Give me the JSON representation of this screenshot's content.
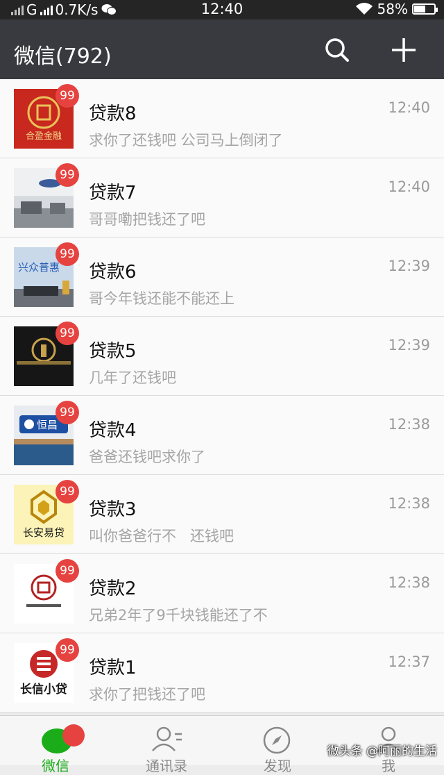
{
  "status_bar": {
    "carrier": "G",
    "speed": "0.7K/s",
    "time": "12:40",
    "battery": "58%",
    "battery_level": 0.58
  },
  "header": {
    "title": "微信(792)",
    "search_icon": "search-icon",
    "add_icon": "plus-icon"
  },
  "chats": [
    {
      "name": "贷款8",
      "time": "12:40",
      "preview": "求你了还钱吧 公司马上倒闭了",
      "badge": "99",
      "avatar_text": "合盈金融"
    },
    {
      "name": "贷款7",
      "time": "12:40",
      "preview": "哥哥嘞把钱还了吧",
      "badge": "99",
      "avatar_text": ""
    },
    {
      "name": "贷款6",
      "time": "12:39",
      "preview": "哥今年钱还能不能还上",
      "badge": "99",
      "avatar_text": "兴众普惠"
    },
    {
      "name": "贷款5",
      "time": "12:39",
      "preview": "几年了还钱吧",
      "badge": "99",
      "avatar_text": ""
    },
    {
      "name": "贷款4",
      "time": "12:38",
      "preview": "爸爸还钱吧求你了",
      "badge": "99",
      "avatar_text": "恒昌"
    },
    {
      "name": "贷款3",
      "time": "12:38",
      "preview": "叫你爸爸行不   还钱吧",
      "badge": "99",
      "avatar_text": "长安易贷"
    },
    {
      "name": "贷款2",
      "time": "12:38",
      "preview": "兄弟2年了9千块钱能还了不",
      "badge": "99",
      "avatar_text": ""
    },
    {
      "name": "贷款1",
      "time": "12:37",
      "preview": "求你了把钱还了吧",
      "badge": "99",
      "avatar_text": "长信小贷"
    }
  ],
  "tabbar": {
    "tabs": [
      {
        "label": "微信",
        "icon": "chat-bubbles-icon",
        "active": true
      },
      {
        "label": "通讯录",
        "icon": "contacts-icon"
      },
      {
        "label": "发现",
        "icon": "compass-icon"
      },
      {
        "label": "我",
        "icon": "person-icon"
      }
    ],
    "watermark": "微头条 @阿丽的生活"
  },
  "colors": {
    "header_bg": "#393a3f",
    "badge": "#e64340",
    "accent": "#1aad19"
  }
}
